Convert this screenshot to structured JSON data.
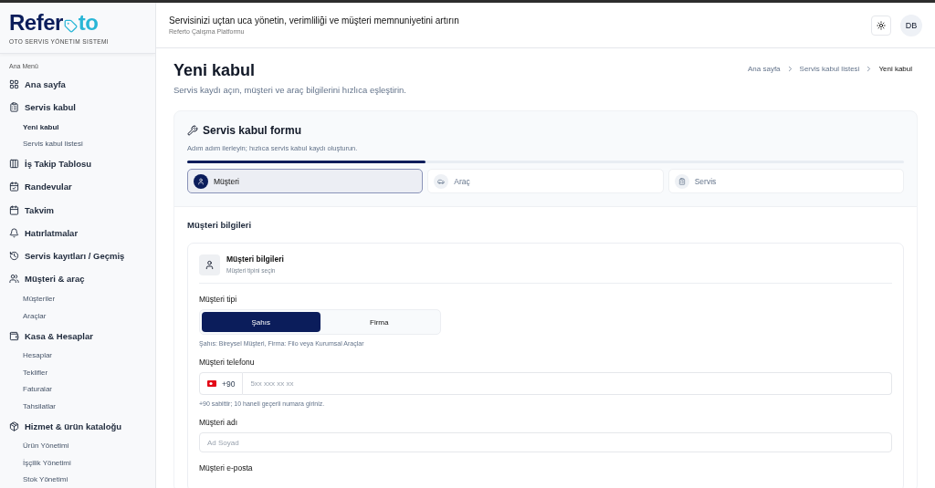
{
  "logo": {
    "part_1": "Refer",
    "part_2": "to",
    "tagline": "OTO SERVIS YÖNETIM SISTEMI"
  },
  "sidebar": {
    "section_label": "Ana Menü",
    "items": [
      {
        "label": "Ana sayfa"
      },
      {
        "label": "Servis kabul",
        "children": [
          {
            "label": "Yeni kabul",
            "selected": true
          },
          {
            "label": "Servis kabul listesi",
            "selected": false
          }
        ]
      },
      {
        "label": "İş Takip Tablosu"
      },
      {
        "label": "Randevular"
      },
      {
        "label": "Takvim"
      },
      {
        "label": "Hatırlatmalar"
      },
      {
        "label": "Servis kayıtları / Geçmiş"
      },
      {
        "label": "Müşteri & araç",
        "children": [
          {
            "label": "Müşteriler",
            "selected": false
          },
          {
            "label": "Araçlar",
            "selected": false
          }
        ]
      },
      {
        "label": "Kasa & Hesaplar",
        "children": [
          {
            "label": "Hesaplar",
            "selected": false
          },
          {
            "label": "Teklifler",
            "selected": false
          },
          {
            "label": "Faturalar",
            "selected": false
          },
          {
            "label": "Tahsilatlar",
            "selected": false
          }
        ]
      },
      {
        "label": "Hizmet & ürün kataloğu",
        "children": [
          {
            "label": "Ürün Yönetimi",
            "selected": false
          },
          {
            "label": "İşçilik Yönetimi",
            "selected": false
          },
          {
            "label": "Stok Yönetimi",
            "selected": false
          }
        ]
      }
    ]
  },
  "header": {
    "title": "Servisinizi uçtan uca yönetin, verimliliği ve müşteri memnuniyetini artırın",
    "subtitle": "Referto Çalışma Platformu",
    "avatar": "DB"
  },
  "page": {
    "title": "Yeni kabul",
    "subtitle": "Servis kaydı açın, müşteri ve araç bilgilerini hızlıca eşleştirin.",
    "breadcrumbs": [
      "Ana sayfa",
      "Servis kabul listesi",
      "Yeni kabul"
    ]
  },
  "form": {
    "title": "Servis kabul formu",
    "subtitle": "Adım adım ilerleyin; hızlıca servis kabul kaydı oluşturun.",
    "progress": {
      "level": 0.333
    },
    "steps": [
      {
        "label": "Müşteri",
        "selected": true
      },
      {
        "label": "Araç",
        "selected": false
      },
      {
        "label": "Servis",
        "selected": false
      }
    ],
    "section_title": "Müşteri bilgileri",
    "panel": {
      "title": "Müşteri bilgileri",
      "subtitle": "Müşteri tipini seçin",
      "customer_type": {
        "label": "Müşteri tipi",
        "options": [
          {
            "label": "Şahıs",
            "selected": true
          },
          {
            "label": "Firma",
            "selected": false
          }
        ],
        "hint": "Şahıs: Bireysel Müşteri, Firma: Filo veya Kurumsal Araçlar"
      },
      "phone": {
        "label": "Müşteri telefonu",
        "prefix": "+90",
        "placeholder": "5xx xxx xx xx",
        "hint": "+90 sabittir; 10 haneli geçerli numara giriniz."
      },
      "name": {
        "label": "Müşteri adı",
        "placeholder": "Ad Soyad"
      },
      "email": {
        "label": "Müşteri e-posta"
      }
    }
  }
}
